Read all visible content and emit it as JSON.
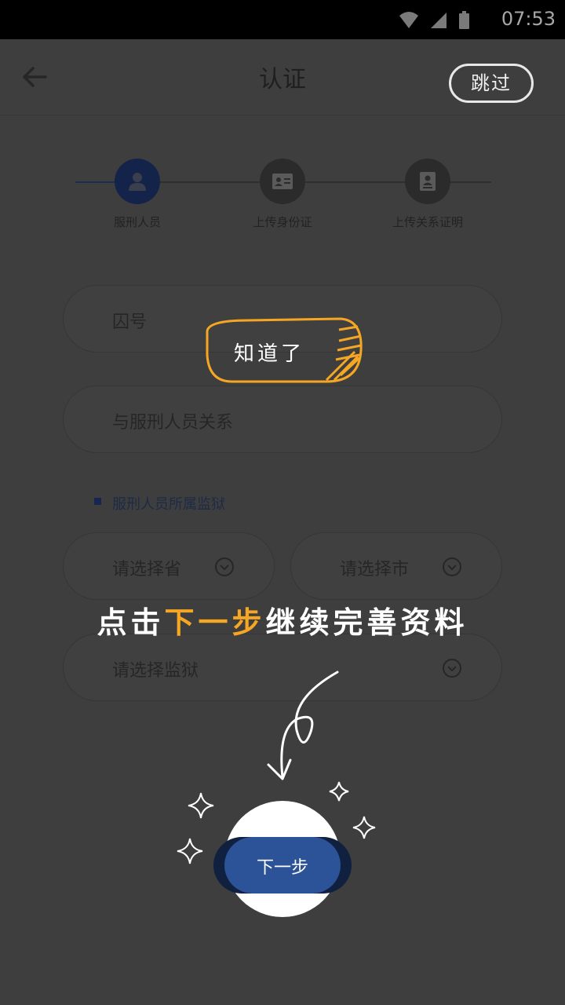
{
  "status_bar": {
    "time": "07:53",
    "icons": [
      "wifi-icon",
      "signal-icon",
      "battery-icon"
    ]
  },
  "header": {
    "title": "认证",
    "skip_label": "跳过"
  },
  "steps": [
    {
      "label": "服刑人员",
      "icon": "person-icon",
      "active": true
    },
    {
      "label": "上传身份证",
      "icon": "id-card-icon",
      "active": false
    },
    {
      "label": "上传关系证明",
      "icon": "document-icon",
      "active": false
    }
  ],
  "form": {
    "prisoner_number_placeholder": "囚号",
    "relation_placeholder": "与服刑人员关系",
    "prison_section_label": "服刑人员所属监狱",
    "province_placeholder": "请选择省",
    "city_placeholder": "请选择市",
    "prison_placeholder": "请选择监狱"
  },
  "guide": {
    "got_it_label": "知道了",
    "tip_prefix": "点击",
    "tip_highlight": "下一步",
    "tip_suffix": "继续完善资料"
  },
  "next_button_label": "下一步",
  "colors": {
    "accent": "#2c5297",
    "highlight": "#f5a623",
    "overlay": "#404040"
  }
}
